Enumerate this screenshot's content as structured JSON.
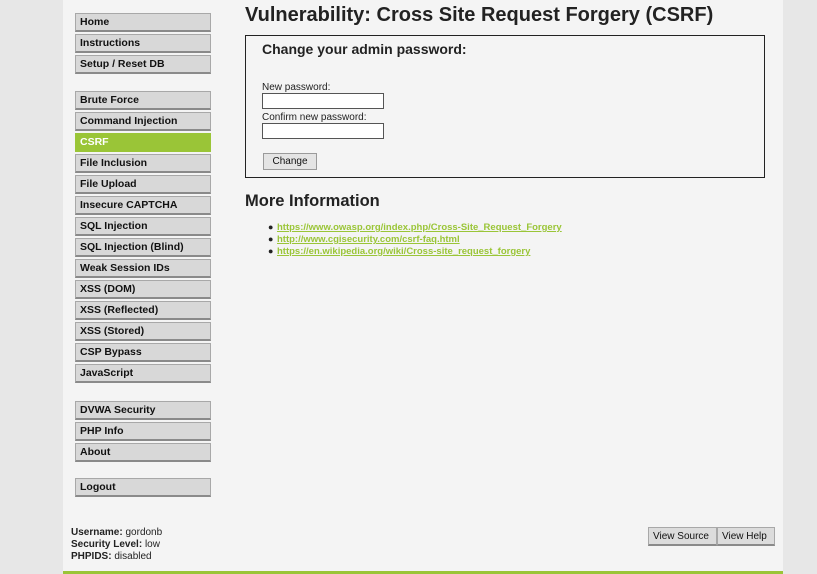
{
  "colors": {
    "accent": "#9ac537",
    "page_bg": "#e7e7e7",
    "content_bg": "#f4f4f4",
    "menu_bg": "#d8d8d8"
  },
  "menu": {
    "group1": [
      "Home",
      "Instructions",
      "Setup / Reset DB"
    ],
    "group2": [
      "Brute Force",
      "Command Injection",
      "CSRF",
      "File Inclusion",
      "File Upload",
      "Insecure CAPTCHA",
      "SQL Injection",
      "SQL Injection (Blind)",
      "Weak Session IDs",
      "XSS (DOM)",
      "XSS (Reflected)",
      "XSS (Stored)",
      "CSP Bypass",
      "JavaScript"
    ],
    "group3": [
      "DVWA Security",
      "PHP Info",
      "About"
    ],
    "group4": [
      "Logout"
    ],
    "selected": "CSRF"
  },
  "page": {
    "title": "Vulnerability: Cross Site Request Forgery (CSRF)"
  },
  "form": {
    "heading": "Change your admin password:",
    "new_password_label": "New password:",
    "new_password_value": "",
    "confirm_password_label": "Confirm new password:",
    "confirm_password_value": "",
    "submit_label": "Change"
  },
  "more_info": {
    "title": "More Information",
    "links": [
      "https://www.owasp.org/index.php/Cross-Site_Request_Forgery",
      "http://www.cgisecurity.com/csrf-faq.html",
      "https://en.wikipedia.org/wiki/Cross-site_request_forgery"
    ]
  },
  "footer": {
    "username_label": "Username:",
    "username": "gordonb",
    "security_label": "Security Level:",
    "security": "low",
    "phpids_label": "PHPIDS:",
    "phpids": "disabled",
    "view_source_label": "View Source",
    "view_help_label": "View Help"
  }
}
